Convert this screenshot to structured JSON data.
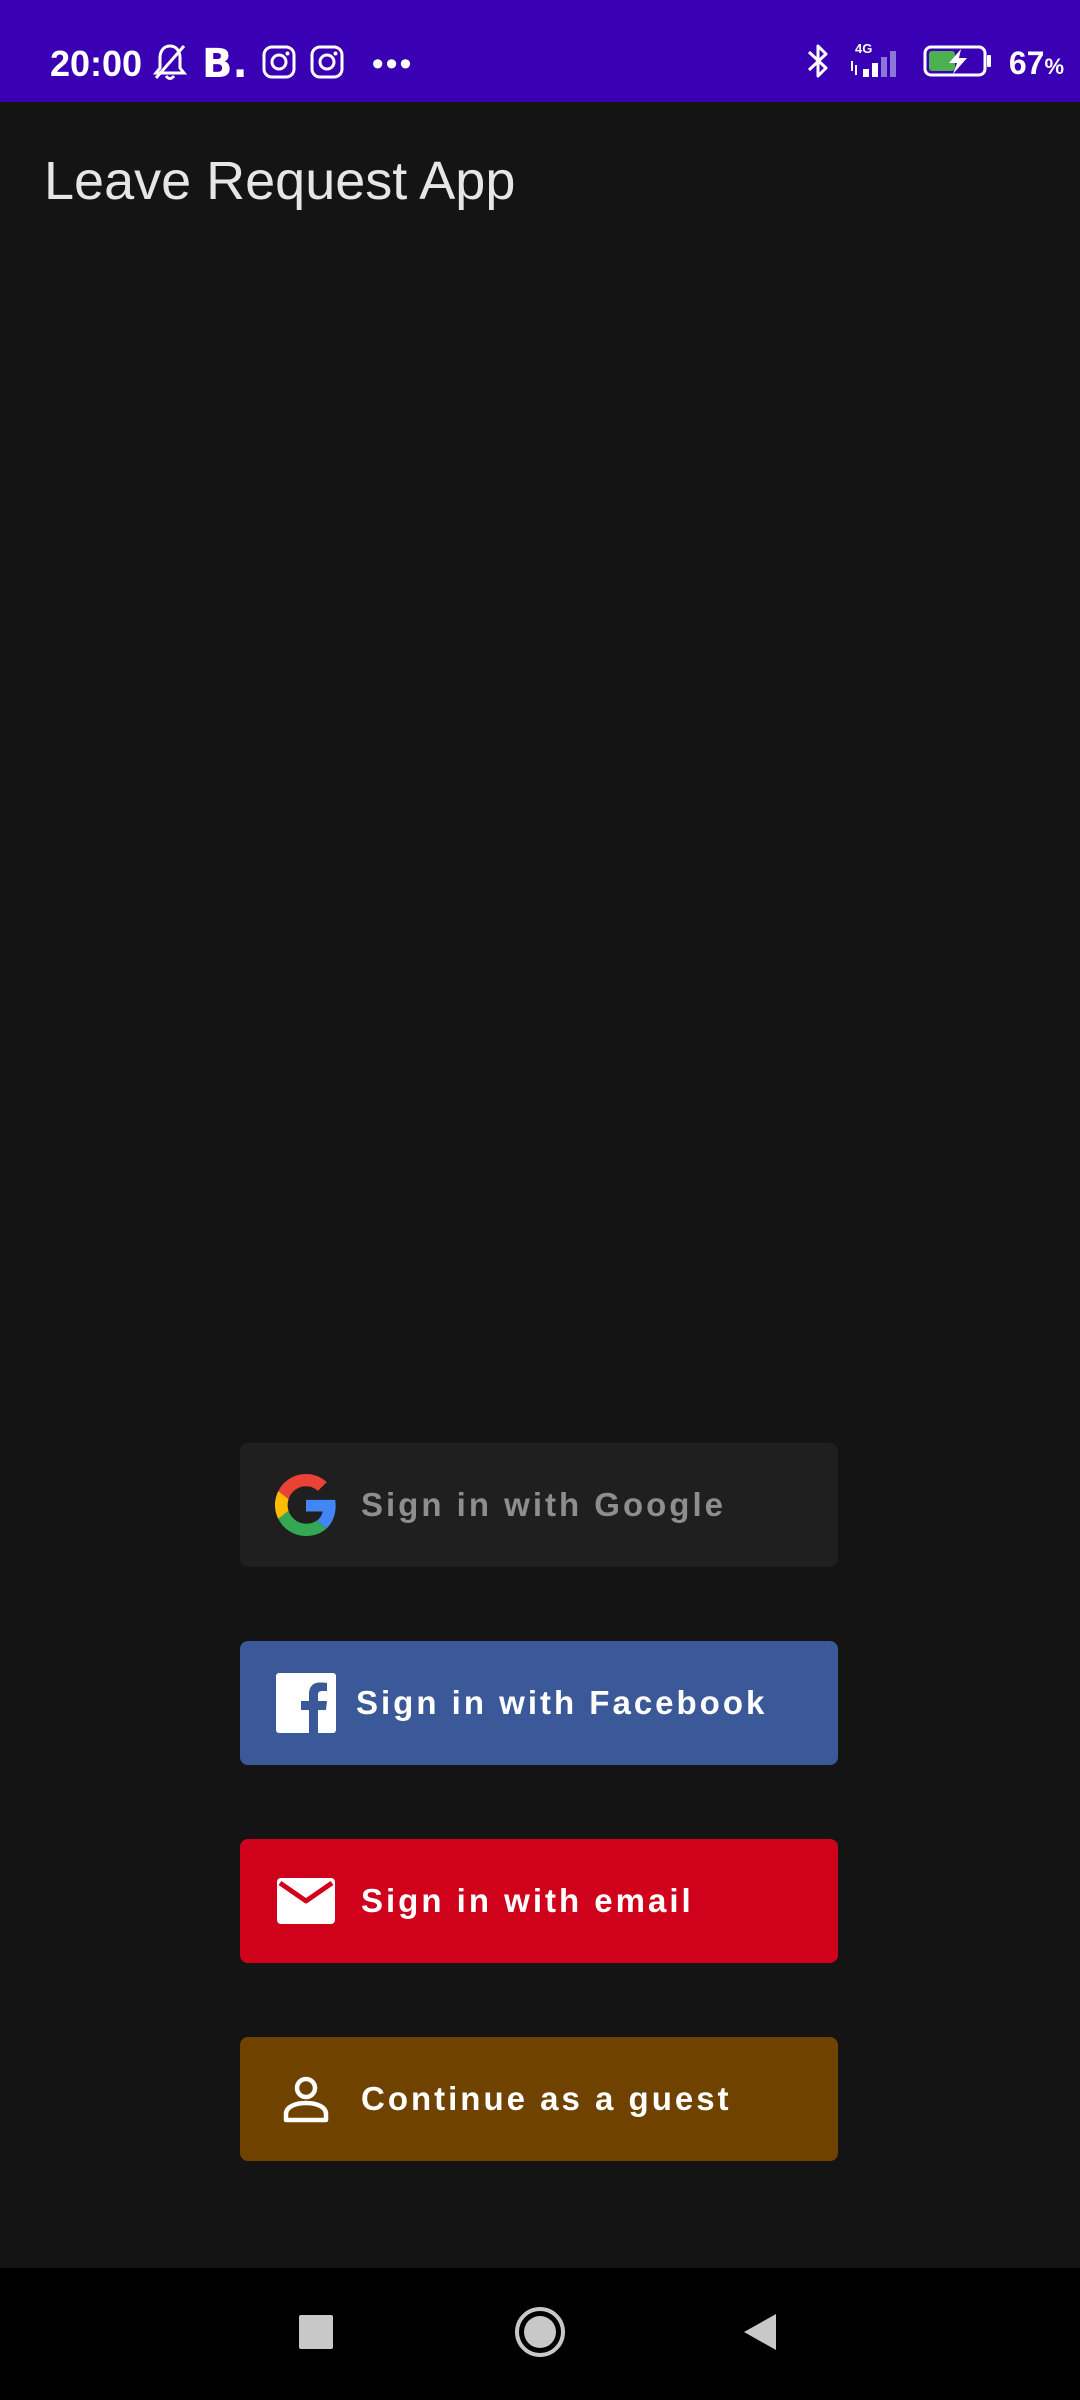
{
  "status_bar": {
    "time": "20:00",
    "brand_letter": "B.",
    "overflow": "•••",
    "network": "4G",
    "battery_percent": "67",
    "battery_unit": "%",
    "background_color": "#3a00b4"
  },
  "app_bar": {
    "title": "Leave Request App"
  },
  "auth_buttons": {
    "google": {
      "label": "Sign in with Google",
      "icon": "google-icon",
      "color": "#1f1f1f"
    },
    "facebook": {
      "label": "Sign in with Facebook",
      "icon": "facebook-icon",
      "color": "#3b5998"
    },
    "email": {
      "label": "Sign in with email",
      "icon": "mail-icon",
      "color": "#d0021b"
    },
    "guest": {
      "label": "Continue as a guest",
      "icon": "person-icon",
      "color": "#6f4200"
    }
  },
  "nav_bar": {
    "recents_icon": "square-icon",
    "home_icon": "circle-icon",
    "back_icon": "triangle-back-icon"
  }
}
